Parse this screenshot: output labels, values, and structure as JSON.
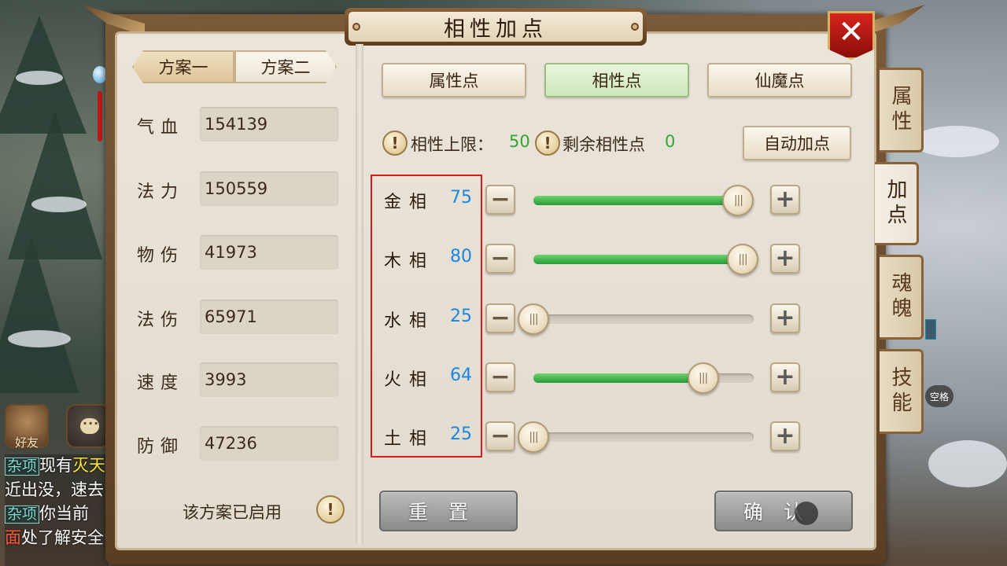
{
  "title": "相性加点",
  "close_symbol": "✕",
  "plans": {
    "plan1": "方案一",
    "plan2": "方案二",
    "active": "plan1"
  },
  "stats": [
    {
      "label": "气血",
      "value": "154139"
    },
    {
      "label": "法力",
      "value": "150559"
    },
    {
      "label": "物伤",
      "value": "41973"
    },
    {
      "label": "法伤",
      "value": "65971"
    },
    {
      "label": "速度",
      "value": "3993"
    },
    {
      "label": "防御",
      "value": "47236"
    }
  ],
  "plan_status": "该方案已启用",
  "info_symbol": "!",
  "category_tabs": [
    {
      "label": "属性点",
      "active": false
    },
    {
      "label": "相性点",
      "active": true
    },
    {
      "label": "仙魔点",
      "active": false
    }
  ],
  "limit": {
    "label": "相性上限：",
    "value": "50"
  },
  "remaining": {
    "label": "剩余相性点",
    "value": "0"
  },
  "auto_button": "自动加点",
  "affinities": [
    {
      "name": "金相",
      "value": "75",
      "fill": 0.93
    },
    {
      "name": "木相",
      "value": "80",
      "fill": 0.95
    },
    {
      "name": "水相",
      "value": "25",
      "fill": 0.0
    },
    {
      "name": "火相",
      "value": "64",
      "fill": 0.77
    },
    {
      "name": "土相",
      "value": "25",
      "fill": 0.0
    }
  ],
  "minus_symbol": "−",
  "plus_symbol": "+",
  "knob_symbol": "|||",
  "reset_button": "重置",
  "confirm_button": "确认",
  "side_tabs": [
    {
      "label": "属性",
      "active": false
    },
    {
      "label": "加点",
      "active": true
    },
    {
      "label": "魂魄",
      "active": false
    },
    {
      "label": "技能",
      "active": false
    }
  ],
  "social": {
    "friends_label": "好友"
  },
  "chat": [
    {
      "tag": "杂项",
      "text": "现有",
      "highlight": "灭天"
    },
    {
      "tag": "",
      "text": "近出没，速去",
      "highlight": ""
    },
    {
      "tag": "杂项",
      "text": "你当前",
      "highlight": ""
    },
    {
      "tag": "",
      "text": "处了解安全",
      "highlight": "面"
    }
  ],
  "space_hint": "空格",
  "colors": {
    "value_blue": "#1a86e0",
    "value_green": "#2ea82e",
    "slider_green": "#2a9a3a",
    "highlight_red": "#e01818",
    "close_red": "#d6241c"
  }
}
